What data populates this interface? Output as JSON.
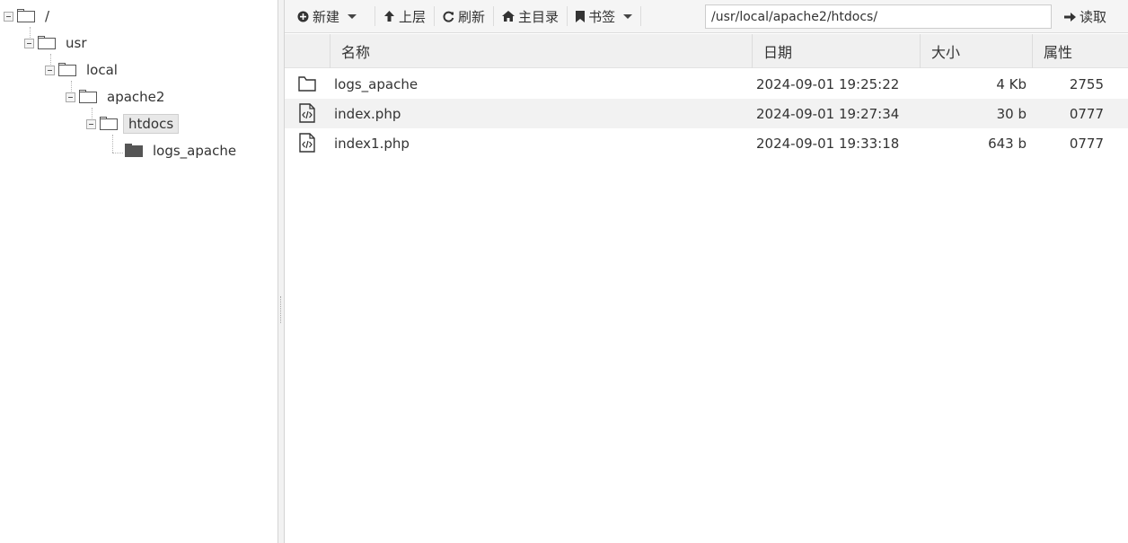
{
  "tree": {
    "nodes": [
      {
        "label": "/",
        "icon": "folder-open-icon"
      },
      {
        "label": "usr",
        "icon": "folder-open-icon"
      },
      {
        "label": "local",
        "icon": "folder-open-icon"
      },
      {
        "label": "apache2",
        "icon": "folder-open-icon"
      },
      {
        "label": "htdocs",
        "icon": "folder-open-icon",
        "selected": true
      },
      {
        "label": "logs_apache",
        "icon": "folder-closed-icon"
      }
    ]
  },
  "toolbar": {
    "new_label": "新建",
    "up_label": "上层",
    "refresh_label": "刷新",
    "home_label": "主目录",
    "bookmark_label": "书签",
    "path_value": "/usr/local/apache2/htdocs/",
    "read_label": "读取"
  },
  "table": {
    "headers": {
      "name": "名称",
      "date": "日期",
      "size": "大小",
      "attr": "属性"
    },
    "rows": [
      {
        "icon": "folder-icon",
        "name": "logs_apache",
        "date": "2024-09-01 19:25:22",
        "size": "4 Kb",
        "attr": "2755"
      },
      {
        "icon": "php-file-icon",
        "name": "index.php",
        "date": "2024-09-01 19:27:34",
        "size": "30 b",
        "attr": "0777"
      },
      {
        "icon": "php-file-icon",
        "name": "index1.php",
        "date": "2024-09-01 19:33:18",
        "size": "643 b",
        "attr": "0777"
      }
    ]
  }
}
